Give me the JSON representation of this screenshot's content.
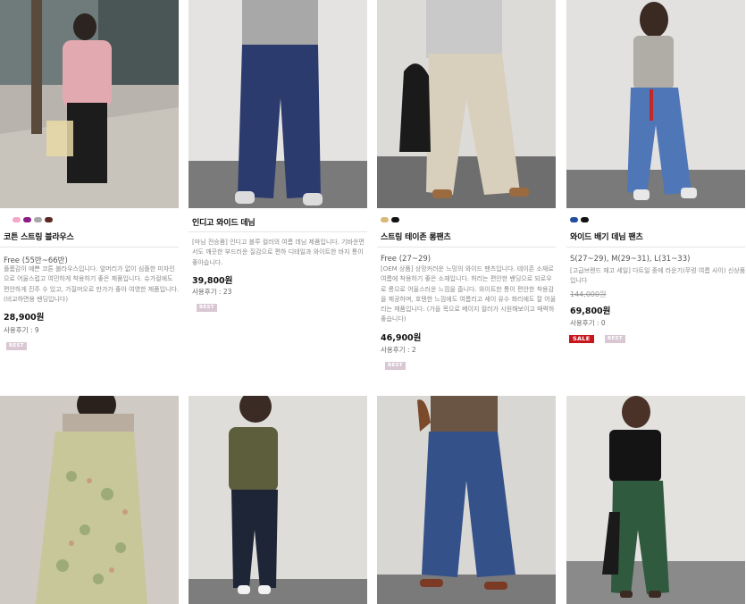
{
  "colors": {
    "best_badge": "#d9c7d4",
    "sale_badge": "#c8161d"
  },
  "products": [
    {
      "swatches": [
        "#f2a6c9",
        "#8b1c86",
        "#a8a8a8",
        "#5a2a22"
      ],
      "name": "코튼 스트링 블라우스",
      "size": "Free (55반~66반)",
      "description": "플룸감이 예쁜 코튼 블라우스입니다. 앞머리가 없이 심플한 미자인으로 어울스럽고 여민하게 착용하기 좋은 제품입니다. 슈가컬에도 편안하게 진주 수 있고, 가질머오로 만가가 좋아 여영한 제품입니다. (비교하면용 밴딩입니다)",
      "price": "28,900원",
      "original_price": "",
      "review": "사용후기 : 9",
      "badges": [
        "BEST"
      ]
    },
    {
      "swatches": [],
      "name": "인디고 와이드 데님",
      "size": "",
      "description": "[마님 전승품] 인디고 블루 컬러의 여름 데님 제품입니다. 기바운면서도 깨끗한 부드러운 질감으로 편하 디테일과 와이트한 바지 통이 좋아습니다.",
      "price": "39,800원",
      "original_price": "",
      "review": "사용후기 : 23",
      "badges": [
        "BEST"
      ]
    },
    {
      "swatches": [
        "#d9b97a",
        "#111111"
      ],
      "name": "스트링 테이존 롱팬츠",
      "size": "Free (27~29)",
      "description": "[OEM 상품] 상망커러운 느밍의 와이드 팬츠입니다. 테이존 소재로 여름에 착용하기 좋은 소재입니다. 허리는 편안한 밴딩으로 되로우로 롱으로 어울스러운 느낌을 줍니다. 와이트한 통이 편안한 착용감을 제공하며, 호텐한 느낌에도 여름리고 세이 유수 화리에도 잘 어울리는 제품입니다. (가을 목으로 베이지 컬러가 시원해보이고 매력하 좋습니다)",
      "price": "46,900원",
      "original_price": "",
      "review": "사용후기 : 2",
      "badges": [
        "BEST"
      ]
    },
    {
      "swatches": [
        "#1f4f9c",
        "#111111"
      ],
      "name": "와이드 배기 데님 팬츠",
      "size": "S(27~29), M(29~31), L(31~33)",
      "description": "[고급브랜드 재고 세일] 다트일 중에 라운기(쭈렁 여름 사이) 신상품입니다",
      "price": "69,800원",
      "original_price": "144,000원",
      "review": "사용후기 : 0",
      "badges": [
        "SALE",
        "BEST"
      ]
    }
  ]
}
